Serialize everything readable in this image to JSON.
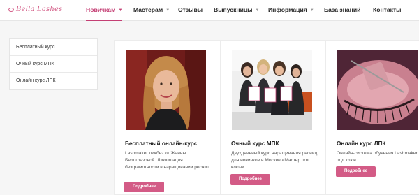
{
  "header": {
    "logo_text": "Bella Lashes",
    "nav": [
      {
        "label": "Новичкам",
        "dropdown": true,
        "active": true
      },
      {
        "label": "Мастерам",
        "dropdown": true,
        "active": false
      },
      {
        "label": "Отзывы",
        "dropdown": false,
        "active": false
      },
      {
        "label": "Выпускницы",
        "dropdown": true,
        "active": false
      },
      {
        "label": "Информация",
        "dropdown": true,
        "active": false
      },
      {
        "label": "База знаний",
        "dropdown": false,
        "active": false
      },
      {
        "label": "Контакты",
        "dropdown": false,
        "active": false
      }
    ]
  },
  "sidebar": {
    "items": [
      {
        "label": "Бесплатный курс"
      },
      {
        "label": "Очный курс МПК"
      },
      {
        "label": "Онлайн курс ЛПК"
      }
    ]
  },
  "cards": [
    {
      "title": "Бесплатный онлайн-курс",
      "description": "Lashmaker ликбез от Жанны Белоглазовой. Ликвидация безграмотности в наращивании ресниц.",
      "button": "Подробнее",
      "photo_icon": "woman-portrait-photo"
    },
    {
      "title": "Очный курс МПК",
      "description": "Двухдневный курс наращивания ресниц для новичков в Москве «Мастер под ключ»",
      "button": "Подробнее",
      "photo_icon": "graduates-with-diplomas-photo"
    },
    {
      "title": "Онлайн курс ЛПК",
      "description": "Онлайн-система обучения Lashmaker под ключ",
      "button": "Подробнее",
      "photo_icon": "eyelash-extension-closeup-photo"
    }
  ],
  "colors": {
    "accent": "#c43f74",
    "button": "#d35b86",
    "background": "#f6f6f6"
  }
}
